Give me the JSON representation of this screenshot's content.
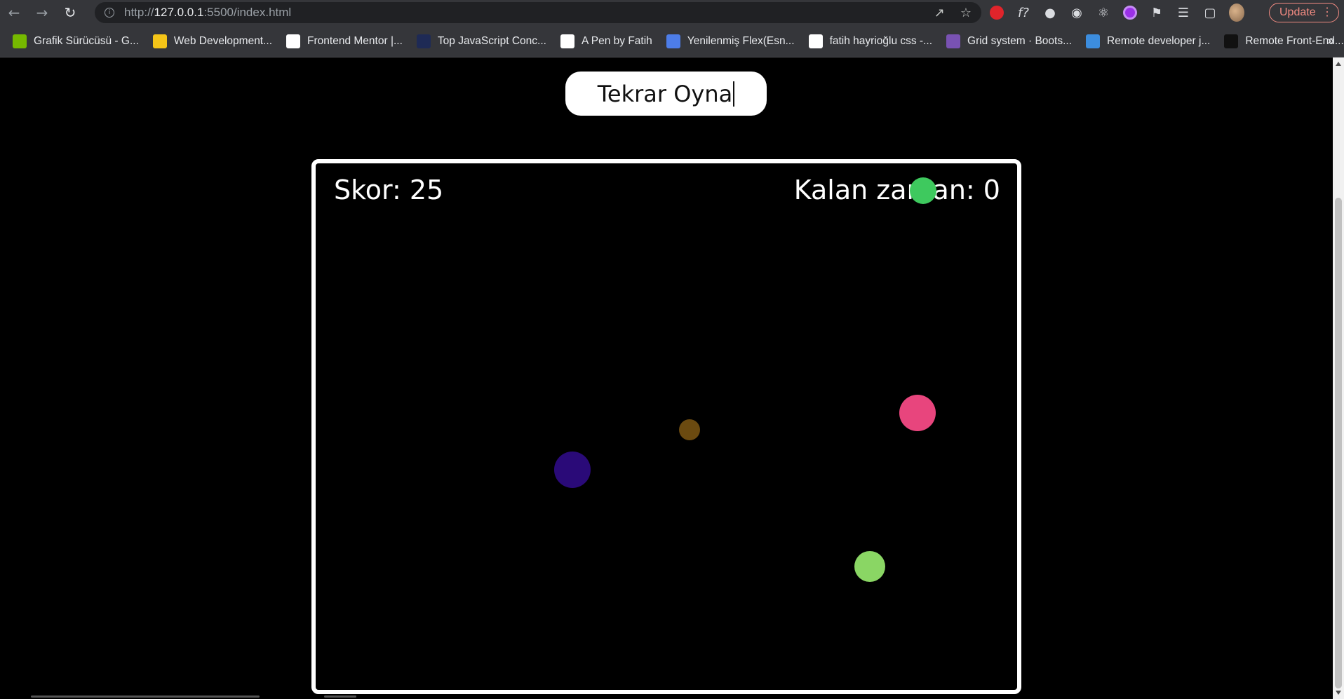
{
  "browser": {
    "url_prefix": "http://",
    "url_host": "127.0.0.1",
    "url_rest": ":5500/index.html",
    "update_label": "Update",
    "more_label": "»"
  },
  "bookmarks": [
    {
      "label": "Grafik Sürücüsü - G...",
      "icon": "nvidia-icon",
      "color": "#76b900"
    },
    {
      "label": "Web Development...",
      "icon": "web-dev-icon",
      "color": "#f5c518"
    },
    {
      "label": "Frontend Mentor |...",
      "icon": "frontend-mentor-icon",
      "color": "#ffffff"
    },
    {
      "label": "Top JavaScript Conc...",
      "icon": "javascript-icon",
      "color": "#1e2a55"
    },
    {
      "label": "A Pen by Fatih",
      "icon": "codepen-icon",
      "color": "#ffffff"
    },
    {
      "label": "Yenilenmiş Flex(Esn...",
      "icon": "hand-icon",
      "color": "#4d7de8"
    },
    {
      "label": "fatih hayrioğlu css -...",
      "icon": "google-icon",
      "color": "#ffffff"
    },
    {
      "label": "Grid system · Boots...",
      "icon": "bootstrap-icon",
      "color": "#7952b3"
    },
    {
      "label": "Remote developer j...",
      "icon": "remote-icon",
      "color": "#3c8dde"
    },
    {
      "label": "Remote Front-End...",
      "icon": "wwr-icon",
      "color": "#111111"
    }
  ],
  "game": {
    "restart_label": "Tekrar Oyna",
    "score_text": "Skor: 25",
    "timer_text": "Kalan zaman: 0",
    "balls": [
      {
        "color": "#3ec95e"
      },
      {
        "color": "#6b4a10"
      },
      {
        "color": "#e8457d"
      },
      {
        "color": "#2a0a78"
      },
      {
        "color": "#8ad664"
      }
    ]
  }
}
